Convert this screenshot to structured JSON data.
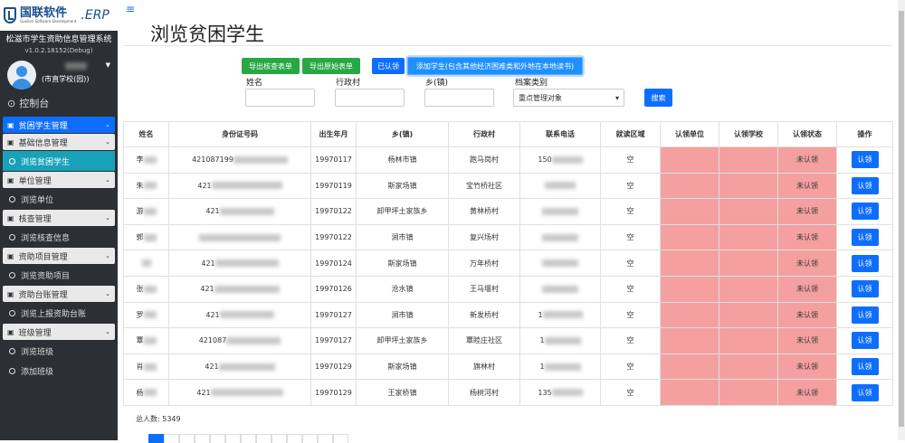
{
  "brand": {
    "name": "国联软件",
    "subtitle": "Guolian Software Development",
    "erp": ".ERP"
  },
  "system": {
    "title": "松滋市学生资助信息管理系统",
    "version": "v1.0.2.18152(Debug)"
  },
  "user": {
    "name": "(市直学校(园))"
  },
  "sidebar": {
    "dashboard": "控制台",
    "items": [
      {
        "type": "group",
        "label": "贫困学生管理",
        "active": true
      },
      {
        "type": "group",
        "label": "基础信息管理"
      },
      {
        "type": "sub",
        "label": "浏览贫困学生",
        "active": true
      },
      {
        "type": "group",
        "label": "单位管理"
      },
      {
        "type": "sub",
        "label": "浏览单位"
      },
      {
        "type": "group",
        "label": "核查管理"
      },
      {
        "type": "sub",
        "label": "浏览核查信息"
      },
      {
        "type": "group",
        "label": "资助项目管理"
      },
      {
        "type": "sub",
        "label": "浏览资助项目"
      },
      {
        "type": "group",
        "label": "资助台账管理"
      },
      {
        "type": "sub",
        "label": "浏览上报资助台账"
      },
      {
        "type": "group",
        "label": "班级管理"
      },
      {
        "type": "sub",
        "label": "浏览班级"
      },
      {
        "type": "sub",
        "label": "添加班级"
      }
    ]
  },
  "page": {
    "title": "浏览贫困学生"
  },
  "toolbar": {
    "export_check": "导出核查表单",
    "export_original": "导出原始表单",
    "approved": "已认领",
    "add_student": "添加学生(包含其他经济困难类和外地在本地读书)"
  },
  "filters": {
    "name_label": "姓名",
    "village_label": "行政村",
    "town_label": "乡(镇)",
    "category_label": "档案类别",
    "category_value": "重点管理对象",
    "search": "搜索"
  },
  "table": {
    "headers": [
      "姓名",
      "身份证号码",
      "出生年月",
      "乡(镇)",
      "行政村",
      "联系电话",
      "就读区域",
      "认领单位",
      "认领学校",
      "认领状态",
      "操作"
    ],
    "action_label": "认领",
    "rows": [
      {
        "name": "李",
        "id": "421087199",
        "birth": "19970117",
        "town": "杨林市镇",
        "village": "跑马岗村",
        "phone": "150",
        "area": "空",
        "status": "未认领"
      },
      {
        "name": "朱",
        "id": "421",
        "birth": "19970119",
        "town": "斯家场镇",
        "village": "宝竹桥社区",
        "phone": "",
        "area": "空",
        "status": "未认领"
      },
      {
        "name": "游",
        "id": "421",
        "birth": "19970122",
        "town": "卸甲坪土家族乡",
        "village": "黄林桥村",
        "phone": "",
        "area": "空",
        "status": "未认领"
      },
      {
        "name": "郭",
        "id": "",
        "birth": "19970122",
        "town": "涧市镇",
        "village": "复兴场村",
        "phone": "",
        "area": "空",
        "status": "未认领"
      },
      {
        "name": "",
        "id": "421",
        "birth": "19970124",
        "town": "斯家场镇",
        "village": "万年桥村",
        "phone": "",
        "area": "空",
        "status": "未认领"
      },
      {
        "name": "张",
        "id": "421",
        "birth": "19970126",
        "town": "沧水镇",
        "village": "王马堰村",
        "phone": "",
        "area": "空",
        "status": "未认领"
      },
      {
        "name": "罗",
        "id": "421",
        "birth": "19970127",
        "town": "涧市镇",
        "village": "新发桥村",
        "phone": "1",
        "area": "空",
        "status": "未认领"
      },
      {
        "name": "覃",
        "id": "421087",
        "birth": "19970127",
        "town": "卸甲坪土家族乡",
        "village": "覃睦庄社区",
        "phone": "1",
        "area": "空",
        "status": "未认领"
      },
      {
        "name": "肖",
        "id": "421",
        "birth": "19970129",
        "town": "斯家场镇",
        "village": "旗林村",
        "phone": "1",
        "area": "空",
        "status": "未认领"
      },
      {
        "name": "杨",
        "id": "421",
        "birth": "19970129",
        "town": "王家桥镇",
        "village": "杨树河村",
        "phone": "135",
        "area": "空",
        "status": "未认领"
      }
    ]
  },
  "footer": {
    "total": "总人数: 5349"
  },
  "colors": {
    "primary": "#0d6efd",
    "success": "#28a745",
    "pink": "#f4a0a0",
    "sidebar": "#2c2f33",
    "activeSub": "#17a2b8"
  }
}
